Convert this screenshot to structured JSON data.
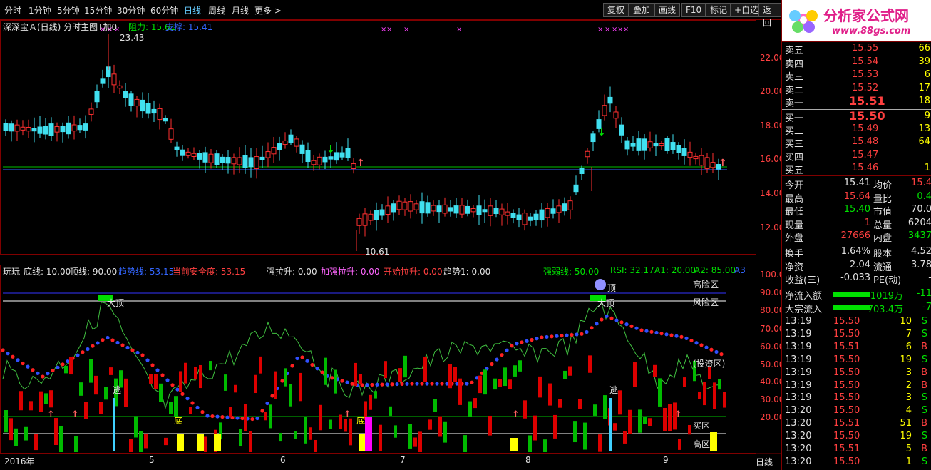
{
  "toolbar": {
    "periods": [
      "分时",
      "1分钟",
      "5分钟",
      "15分钟",
      "30分钟",
      "60分钟",
      "日线",
      "周线",
      "月线",
      "更多 >"
    ],
    "active_period": "日线",
    "buttons": [
      "复权",
      "叠加",
      "画线",
      "F10",
      "标记",
      "+自选",
      "返回"
    ]
  },
  "main_legend": {
    "title": "深深宝Ａ(日线) 分时主图T加0",
    "resistance_label": "阻力: 15.61",
    "support_label": "支撑: 15.41"
  },
  "price_axis": [
    "22.00",
    "20.00",
    "18.00",
    "16.00",
    "14.00",
    "12.00"
  ],
  "price_annotations": {
    "high": "23.43",
    "low": "10.61"
  },
  "sub_legend": {
    "name": "玩玩",
    "bottom_line": "底线: 10.00",
    "top_line": "顶线: 90.00",
    "trend_line": "趋势线: 53.15",
    "safety": "当前安全度: 53.15",
    "strong_rise": "强拉升: 0.00",
    "plus_rise": "加强拉升: 0.00",
    "start_rise": "开始拉升: 0.00",
    "trend1": "趋势1: 0.00",
    "strength": "强弱线: 50.00",
    "rsi": "RSI: 32.17",
    "a1": "A1: 20.00",
    "a2": "A2: 85.00",
    "a3": "A3"
  },
  "sub_axis": [
    "100.00",
    "90.00",
    "80.00",
    "70.00",
    "60.00",
    "50.00",
    "40.00",
    "30.00",
    "20.00"
  ],
  "sub_labels": {
    "high_risk": "高险区",
    "risk": "风险区",
    "invest": "(投资区)",
    "big_top1": "大顶",
    "big_top2": "大顶",
    "top1": "顶",
    "top2": "顶",
    "escape1": "逃",
    "escape2": "逃",
    "bottom1": "底",
    "bottom2": "底",
    "buy_zone": "买区",
    "low_zone": "高区"
  },
  "date_axis": [
    "2016年",
    "5",
    "6",
    "7",
    "8",
    "9"
  ],
  "footer_label": "日线",
  "logo": {
    "text": "分析家公式网",
    "url_text": "www.88gs.com"
  },
  "orderbook": {
    "sell": [
      {
        "label": "卖五",
        "price": "15.55",
        "vol": "66"
      },
      {
        "label": "卖四",
        "price": "15.54",
        "vol": "39"
      },
      {
        "label": "卖三",
        "price": "15.53",
        "vol": "6"
      },
      {
        "label": "卖二",
        "price": "15.52",
        "vol": "17"
      },
      {
        "label": "卖一",
        "price": "15.51",
        "vol": "18"
      }
    ],
    "buy": [
      {
        "label": "买一",
        "price": "15.50",
        "vol": "9"
      },
      {
        "label": "买二",
        "price": "15.49",
        "vol": "13"
      },
      {
        "label": "买三",
        "price": "15.48",
        "vol": "64"
      },
      {
        "label": "买四",
        "price": "15.47",
        "vol": ""
      },
      {
        "label": "买五",
        "price": "15.46",
        "vol": "1"
      }
    ]
  },
  "quote": [
    {
      "l1": "今开",
      "v1": "15.41",
      "c1": "white",
      "l2": "均价",
      "v2": "15.4",
      "c2": "red"
    },
    {
      "l1": "最高",
      "v1": "15.64",
      "c1": "red",
      "l2": "量比",
      "v2": "0.4",
      "c2": "green"
    },
    {
      "l1": "最低",
      "v1": "15.40",
      "c1": "green",
      "l2": "市值",
      "v2": "70.0",
      "c2": "white"
    },
    {
      "l1": "现量",
      "v1": "1",
      "c1": "red",
      "l2": "总量",
      "v2": "6204",
      "c2": "white"
    },
    {
      "l1": "外盘",
      "v1": "27666",
      "c1": "red",
      "l2": "内盘",
      "v2": "3437",
      "c2": "green"
    }
  ],
  "finance": [
    {
      "l1": "换手",
      "v1": "1.64%",
      "l2": "股本",
      "v2": "4.52"
    },
    {
      "l1": "净资",
      "v1": "2.04",
      "l2": "流通",
      "v2": "3.78"
    },
    {
      "l1": "收益(三)",
      "v1": "-0.033",
      "l2": "PE(动)",
      "v2": "-"
    }
  ],
  "flows": [
    {
      "label": "净流入额",
      "value": "-1019万",
      "value2": "-11"
    },
    {
      "label": "大宗流入",
      "value": "-703.4万",
      "value2": "-7"
    }
  ],
  "ticks": [
    {
      "t": "13:19",
      "p": "15.50",
      "v": "10",
      "s": "S"
    },
    {
      "t": "13:19",
      "p": "15.50",
      "v": "7",
      "s": "S"
    },
    {
      "t": "13:19",
      "p": "15.51",
      "v": "6",
      "s": "B"
    },
    {
      "t": "13:19",
      "p": "15.50",
      "v": "19",
      "s": "S"
    },
    {
      "t": "13:19",
      "p": "15.50",
      "v": "3",
      "s": "B"
    },
    {
      "t": "13:19",
      "p": "15.50",
      "v": "2",
      "s": "B"
    },
    {
      "t": "13:19",
      "p": "15.50",
      "v": "3",
      "s": "S"
    },
    {
      "t": "13:20",
      "p": "15.50",
      "v": "4",
      "s": "S"
    },
    {
      "t": "13:20",
      "p": "15.51",
      "v": "51",
      "s": "B"
    },
    {
      "t": "13:20",
      "p": "15.50",
      "v": "19",
      "s": "S"
    },
    {
      "t": "13:20",
      "p": "15.51",
      "v": "5",
      "s": "B"
    },
    {
      "t": "13:20",
      "p": "15.50",
      "v": "1",
      "s": "S"
    }
  ]
}
